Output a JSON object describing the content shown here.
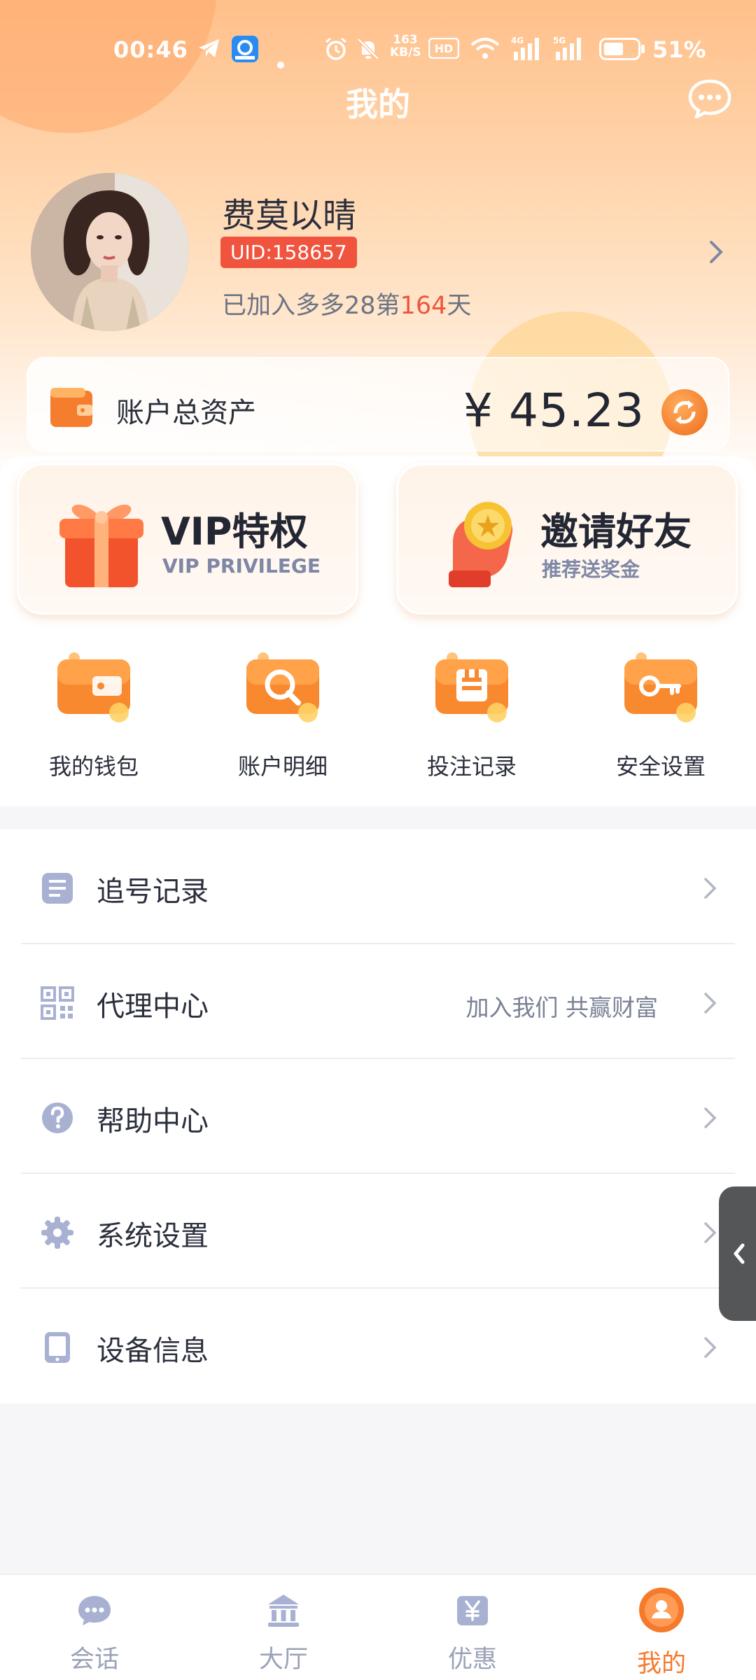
{
  "status_bar": {
    "time": "00:46",
    "network_speed": "163\nKB/S",
    "battery": "51%",
    "icons": [
      "telegram-icon",
      "app-icon",
      "dot-icon",
      "alarm-icon",
      "mute-icon",
      "speed-icon",
      "hd-icon",
      "wifi-icon",
      "4g-signal-icon",
      "5g-signal-icon",
      "battery-icon"
    ]
  },
  "header": {
    "title": "我的",
    "chat_icon": "chat-bubble-icon"
  },
  "profile": {
    "name": "费莫以晴",
    "uid": "UID:158657",
    "joined_prefix": "已加入多多28第",
    "joined_days": "164",
    "joined_suffix": "天"
  },
  "assets": {
    "label": "账户总资产",
    "amount": "¥ 45.23"
  },
  "promos": [
    {
      "title": "VIP特权",
      "subtitle": "VIP PRIVILEGE",
      "icon": "gift-box-icon"
    },
    {
      "title": "邀请好友",
      "subtitle": "推荐送奖金",
      "icon": "hand-coin-icon"
    }
  ],
  "quick_actions": [
    {
      "label": "我的钱包",
      "icon": "wallet-icon"
    },
    {
      "label": "账户明细",
      "icon": "magnifier-icon"
    },
    {
      "label": "投注记录",
      "icon": "bet-record-icon"
    },
    {
      "label": "安全设置",
      "icon": "key-icon"
    }
  ],
  "menu": [
    {
      "label": "追号记录",
      "note": "",
      "icon": "document-icon"
    },
    {
      "label": "代理中心",
      "note": "加入我们 共赢财富",
      "icon": "qr-code-icon"
    },
    {
      "label": "帮助中心",
      "note": "",
      "icon": "question-icon"
    },
    {
      "label": "系统设置",
      "note": "",
      "icon": "gear-icon"
    },
    {
      "label": "设备信息",
      "note": "",
      "icon": "tablet-icon"
    }
  ],
  "bottom_nav": [
    {
      "label": "会话",
      "icon": "chat-icon",
      "active": false
    },
    {
      "label": "大厅",
      "icon": "bank-icon",
      "active": false
    },
    {
      "label": "优惠",
      "icon": "yen-ticket-icon",
      "active": false
    },
    {
      "label": "我的",
      "icon": "user-icon",
      "active": true
    }
  ],
  "colors": {
    "accent": "#f57a2c",
    "badge": "#f0543e",
    "header_gradient_top": "#ffc08a"
  }
}
